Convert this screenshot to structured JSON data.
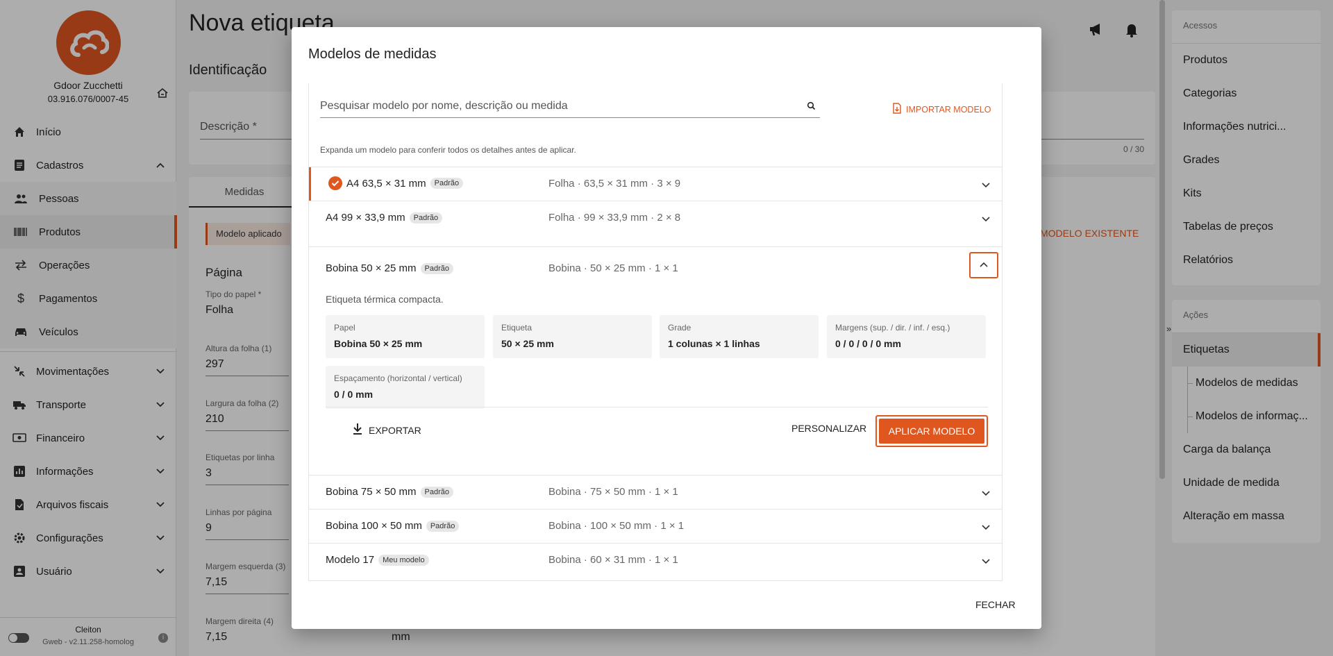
{
  "colors": {
    "accent": "#e0561f"
  },
  "sidebar": {
    "company_name": "Gdoor Zucchetti",
    "company_cnpj": "03.916.076/0007-45",
    "items": [
      {
        "label": "Início",
        "icon": "home-icon"
      },
      {
        "label": "Cadastros",
        "icon": "list-icon"
      },
      {
        "label": "Pessoas",
        "icon": "people-icon"
      },
      {
        "label": "Produtos",
        "icon": "barcode-icon"
      },
      {
        "label": "Operações",
        "icon": "swap-icon"
      },
      {
        "label": "Pagamentos",
        "icon": "dollar-icon"
      },
      {
        "label": "Veículos",
        "icon": "car-icon"
      },
      {
        "label": "Movimentações",
        "icon": "movement-icon"
      },
      {
        "label": "Transporte",
        "icon": "truck-icon"
      },
      {
        "label": "Financeiro",
        "icon": "money-icon"
      },
      {
        "label": "Informações",
        "icon": "chart-icon"
      },
      {
        "label": "Arquivos fiscais",
        "icon": "file-icon"
      },
      {
        "label": "Configurações",
        "icon": "settings-icon"
      },
      {
        "label": "Usuário",
        "icon": "user-icon"
      }
    ],
    "footer_user": "Cleiton",
    "footer_version": "Gweb - v2.11.258-homolog"
  },
  "main": {
    "title": "Nova etiqueta",
    "section": "Identificação",
    "descricao_label": "Descrição *",
    "counter": "0 / 30",
    "tab_medidas": "Medidas",
    "applied": "Modelo aplicado",
    "modelo_existente": "MODELO EXISTENTE",
    "pagina": "Página",
    "fields": [
      {
        "label": "Tipo do papel *",
        "value": "Folha"
      },
      {
        "label": "Altura da folha (1)",
        "value": "297"
      },
      {
        "label": "Largura da folha (2)",
        "value": "210"
      },
      {
        "label": "Etiquetas por linha",
        "value": "3"
      },
      {
        "label": "Linhas por página",
        "value": "9"
      },
      {
        "label": "Margem esquerda (3)",
        "value": "7,15"
      },
      {
        "label": "Margem direita (4)",
        "value": "7,15"
      }
    ],
    "unit": "mm"
  },
  "right_panel": {
    "acessos_title": "Acessos",
    "acessos": [
      {
        "label": "Produtos"
      },
      {
        "label": "Categorias"
      },
      {
        "label": "Informações nutrici..."
      },
      {
        "label": "Grades"
      },
      {
        "label": "Kits"
      },
      {
        "label": "Tabelas de preços"
      },
      {
        "label": "Relatórios"
      }
    ],
    "acoes_title": "Ações",
    "acoes": [
      {
        "label": "Etiquetas"
      },
      {
        "label": "Modelos de medidas"
      },
      {
        "label": "Modelos de informaç..."
      },
      {
        "label": "Carga da balança"
      },
      {
        "label": "Unidade de medida"
      },
      {
        "label": "Alteração em massa"
      }
    ]
  },
  "modal": {
    "title": "Modelos de medidas",
    "search_placeholder": "Pesquisar modelo por nome, descrição ou medida",
    "import_label": "IMPORTAR MODELO",
    "hint": "Expanda um modelo para conferir todos os detalhes antes de aplicar.",
    "models": [
      {
        "name": "A4 63,5 × 31 mm",
        "badge": "Padrão",
        "desc": "Folha · 63,5 × 31 mm · 3 × 9"
      },
      {
        "name": "A4 99 × 33,9 mm",
        "badge": "Padrão",
        "desc": "Folha · 99 × 33,9 mm · 2 × 8"
      },
      {
        "name": "Bobina 50 × 25 mm",
        "badge": "Padrão",
        "desc": "Bobina · 50 × 25 mm · 1 × 1"
      },
      {
        "name": "Bobina 75 × 50 mm",
        "badge": "Padrão",
        "desc": "Bobina · 75 × 50 mm · 1 × 1"
      },
      {
        "name": "Bobina 100 × 50 mm",
        "badge": "Padrão",
        "desc": "Bobina · 100 × 50 mm · 1 × 1"
      },
      {
        "name": "Modelo 17",
        "badge": "Meu modelo",
        "desc": "Bobina · 60 × 31 mm · 1 × 1"
      }
    ],
    "expanded": {
      "description": "Etiqueta térmica compacta.",
      "details": [
        {
          "label": "Papel",
          "value": "Bobina 50 × 25 mm"
        },
        {
          "label": "Etiqueta",
          "value": "50 × 25 mm"
        },
        {
          "label": "Grade",
          "value": "1 colunas × 1 linhas"
        },
        {
          "label": "Margens (sup. / dir. / inf. / esq.)",
          "value": "0 / 0 / 0 / 0 mm"
        },
        {
          "label": "Espaçamento (horizontal / vertical)",
          "value": "0 / 0 mm"
        }
      ],
      "export_label": "EXPORTAR",
      "customize_label": "PERSONALIZAR",
      "apply_label": "APLICAR MODELO"
    },
    "close_label": "FECHAR"
  }
}
